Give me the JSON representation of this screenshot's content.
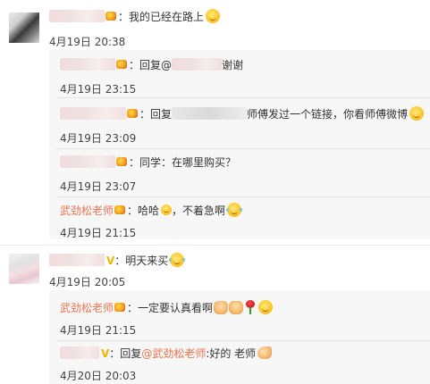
{
  "comments": [
    {
      "text": "：我的已经在路上",
      "time": "4月19日 20:38",
      "replies": [
        {
          "text_before": "：回复@",
          "text_after": "谢谢",
          "time": "4月19日 23:15"
        },
        {
          "text_before": "：回复",
          "text_after": "师傅发过一个链接，你看师傅微博",
          "time": "4月19日 23:09"
        },
        {
          "text": "：同学：在哪里购买？",
          "time": "4月19日 23:07"
        },
        {
          "author": "武劲松老师",
          "text": "：哈哈",
          "text_tail": "，不着急啊",
          "time": "4月19日 21:15"
        }
      ]
    },
    {
      "text": "：明天来买",
      "time": "4月19日 20:05",
      "replies": [
        {
          "author": "武劲松老师",
          "text": "：一定要认真看啊",
          "time": "4月19日 21:15"
        },
        {
          "text_before": "：回复",
          "mention": "@武劲松老师",
          "text_after": ":好的   老师",
          "time": "4月20日 20:03"
        }
      ]
    }
  ],
  "icons": {
    "vip_badge": "vip-badge-icon",
    "verified_badge": "verified-v-icon",
    "smile_emoji": "smile-emoji-icon",
    "laugh_tears_emoji": "laugh-tears-emoji-icon",
    "fist_emoji": "fist-emoji-icon",
    "rose_emoji": "rose-emoji-icon",
    "muscle_emoji": "muscle-emoji-icon"
  },
  "colors": {
    "author_link": "#eb7350",
    "reply_background": "#f7f7f7",
    "text": "#333333"
  }
}
